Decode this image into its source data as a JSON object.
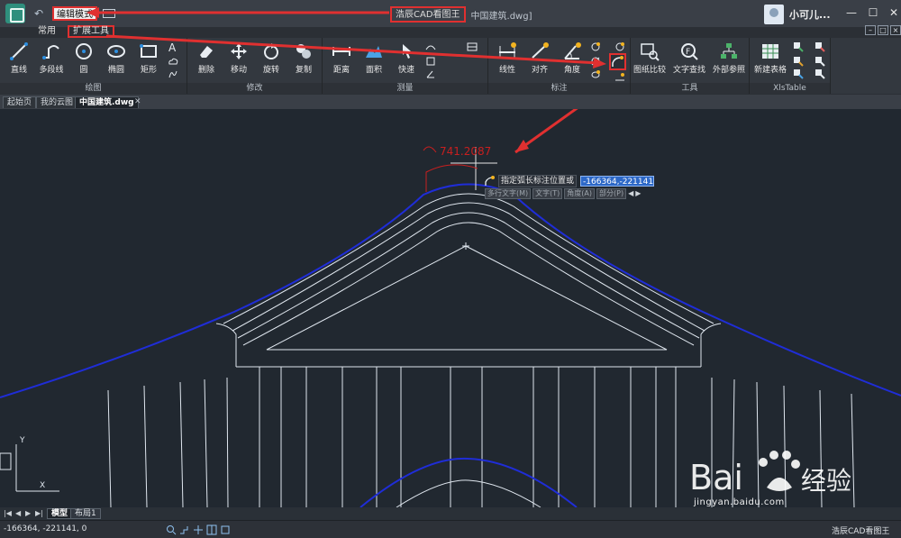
{
  "title_bar": {
    "edit_mode_label": "编辑模式",
    "app_name": "浩辰CAD看图王",
    "doc_name": "中国建筑.dwg]",
    "user_name": "小可儿..."
  },
  "window_controls": [
    "minimize",
    "maximize",
    "close"
  ],
  "ribbon_tabs": [
    {
      "label": "常用",
      "active": false
    },
    {
      "label": "扩展工具",
      "active": true
    }
  ],
  "ribbon": {
    "draw": {
      "title": "绘图",
      "tools": [
        "直线",
        "多段线",
        "圆",
        "椭圆",
        "矩形"
      ]
    },
    "modify": {
      "title": "修改",
      "tools": [
        "删除",
        "移动",
        "旋转",
        "复制"
      ]
    },
    "measure": {
      "title": "测量",
      "tools": [
        "距离",
        "面积",
        "快速"
      ]
    },
    "dimension": {
      "title": "标注",
      "tools": [
        "线性",
        "对齐",
        "角度"
      ]
    },
    "utilities": {
      "title": "工具",
      "tools": [
        "图纸比较",
        "文字查找",
        "外部参照"
      ]
    },
    "xlstable": {
      "title": "XlsTable",
      "tools": [
        "新建表格"
      ]
    }
  },
  "doc_tabs": [
    {
      "label": "起始页",
      "active": false
    },
    {
      "label": "我的云图",
      "active": false
    },
    {
      "label": "中国建筑.dwg",
      "active": true
    }
  ],
  "canvas": {
    "dimension_value": "741.2087",
    "prompt_text": "指定弧长标注位置或",
    "prompt_input": "-166364,-221141",
    "options": [
      "多行文字(M)",
      "文字(T)",
      "角度(A)",
      "部分(P)"
    ]
  },
  "layout_tabs": [
    {
      "label": "模型",
      "active": true
    },
    {
      "label": "布局1",
      "active": false
    }
  ],
  "status": {
    "coordinates": "-166364, -221141, 0",
    "right_label": "浩辰CAD看图王"
  },
  "watermark": {
    "text": "jingyan.baidu.com"
  },
  "colors": {
    "annotation_red": "#e03030",
    "canvas_bg": "#212830",
    "blue_curve": "#1f2dd7",
    "dimension_red": "#c81f1f"
  }
}
